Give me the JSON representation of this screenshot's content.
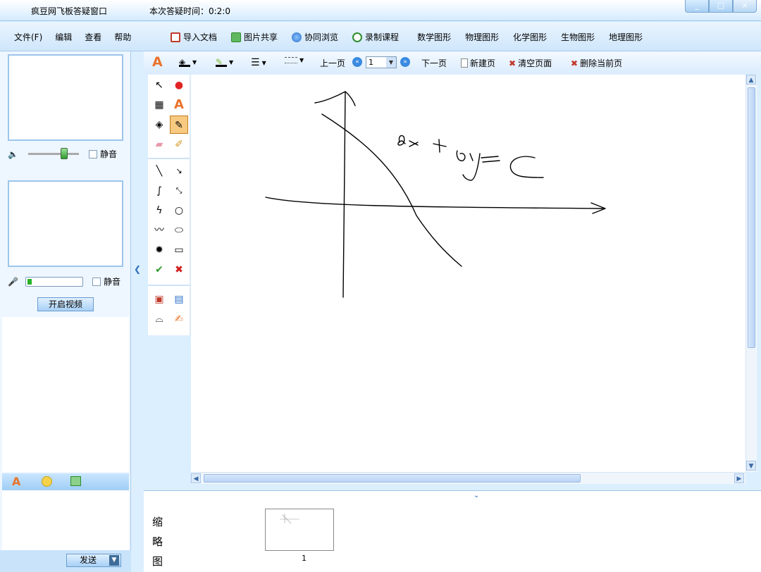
{
  "window": {
    "title": "疯豆网飞板答疑窗口",
    "timer_label": "本次答疑时间：0:2:0",
    "controls": [
      "_",
      "□",
      "×"
    ]
  },
  "menu": [
    "文件(F)",
    "编辑",
    "查看",
    "帮助"
  ],
  "top_buttons": [
    {
      "label": "导入文档",
      "icon": "import-doc-icon",
      "color": "#c0392b"
    },
    {
      "label": "图片共享",
      "icon": "image-share-icon",
      "color": "#2e8b2e"
    },
    {
      "label": "协同浏览",
      "icon": "browse-icon",
      "color": "#2a6fc9"
    },
    {
      "label": "录制课程",
      "icon": "record-icon",
      "color": "#2e8b2e"
    },
    {
      "label": "数学图形"
    },
    {
      "label": "物理图形"
    },
    {
      "label": "化学图形"
    },
    {
      "label": "生物图形"
    },
    {
      "label": "地理图形"
    }
  ],
  "left_panel": {
    "mute_label_1": "静音",
    "mute_label_2": "静音",
    "video_button": "开启视频",
    "send_button": "发送"
  },
  "canvas_toolbar": {
    "prev_page": "上一页",
    "page_value": "1",
    "next_page": "下一页",
    "new_page": "新建页",
    "clear_page": "清空页面",
    "delete_page": "删除当前页"
  },
  "drawing": {
    "equation_text": "ax + by = c",
    "stroke_color": "#000000"
  },
  "thumbnails": {
    "label": "缩略图",
    "pages": [
      "1"
    ]
  },
  "colors": {
    "accent": "#2e6fb7",
    "selected_tool": "#f7c981"
  }
}
